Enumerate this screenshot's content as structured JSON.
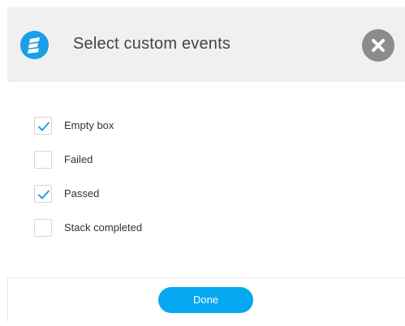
{
  "dialog": {
    "title": "Select custom events",
    "logo_icon": "bricks-logo-icon",
    "close_icon": "close-icon"
  },
  "events": [
    {
      "label": "Empty box",
      "checked": true
    },
    {
      "label": "Failed",
      "checked": false
    },
    {
      "label": "Passed",
      "checked": true
    },
    {
      "label": "Stack completed",
      "checked": false
    }
  ],
  "footer": {
    "done_label": "Done"
  },
  "colors": {
    "accent": "#05a8f0",
    "logo": "#1a9fe8",
    "header_bg": "#f0f0f0",
    "close_bg": "#8c8c8c",
    "check": "#1a9fe8"
  }
}
